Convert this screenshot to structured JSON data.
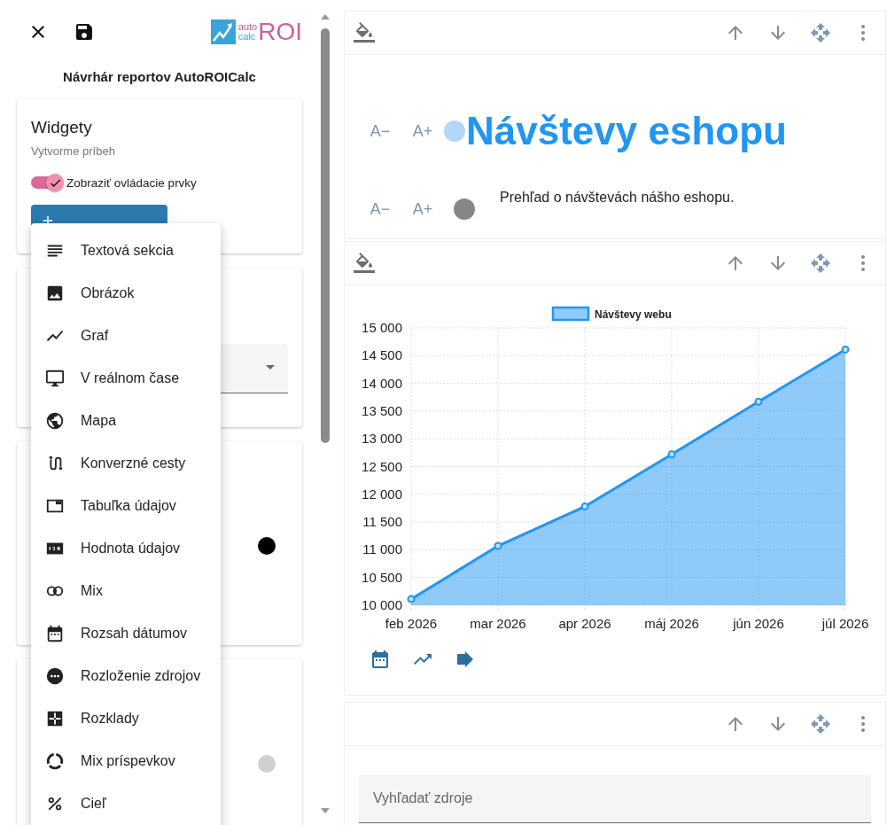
{
  "header": {
    "logo": {
      "top": "auto",
      "bottom": "calc",
      "main": "ROI"
    },
    "title": "Návrhár reportov AutoROICalc"
  },
  "widgets_card": {
    "title": "Widgety",
    "subtitle": "Vytvorme príbeh",
    "toggle": {
      "label": "Zobraziť ovládacie prvky",
      "on": true
    }
  },
  "add_menu": {
    "items": [
      {
        "label": "Textová sekcia"
      },
      {
        "label": "Obrázok"
      },
      {
        "label": "Graf"
      },
      {
        "label": "V reálnom čase"
      },
      {
        "label": "Mapa"
      },
      {
        "label": "Konverzné cesty"
      },
      {
        "label": "Tabuľka údajov"
      },
      {
        "label": "Hodnota údajov"
      },
      {
        "label": "Mix"
      },
      {
        "label": "Rozsah dátumov"
      },
      {
        "label": "Rozloženie zdrojov"
      },
      {
        "label": "Rozklady"
      },
      {
        "label": "Mix príspevkov"
      },
      {
        "label": "Cieľ"
      }
    ]
  },
  "text_widget": {
    "rows": [
      {
        "kind": "title",
        "decrease": "A−",
        "increase": "A+",
        "text": "Návštevy eshopu"
      },
      {
        "kind": "body",
        "decrease": "A−",
        "increase": "A+",
        "text": "Prehľad o návštevách nášho eshopu."
      }
    ]
  },
  "chart_widget": {
    "chart_data": {
      "type": "area",
      "categories": [
        "feb 2026",
        "mar 2026",
        "apr 2026",
        "máj 2026",
        "jún 2026",
        "júl 2026"
      ],
      "series": [
        {
          "name": "Návštevy webu",
          "color": "#2196f3",
          "values": [
            10110,
            11070,
            11780,
            12720,
            13670,
            14610
          ]
        }
      ],
      "ylim": [
        10000,
        15000
      ],
      "grid": true,
      "yticks": [
        {
          "value": 10000,
          "label": "10 000"
        },
        {
          "value": 10500,
          "label": "10 500"
        },
        {
          "value": 11000,
          "label": "11 000"
        },
        {
          "value": 11500,
          "label": "11 500"
        },
        {
          "value": 12000,
          "label": "12 000"
        },
        {
          "value": 12500,
          "label": "12 500"
        },
        {
          "value": 13000,
          "label": "13 000"
        },
        {
          "value": 13500,
          "label": "13 500"
        },
        {
          "value": 14000,
          "label": "14 000"
        },
        {
          "value": 14500,
          "label": "14 500"
        },
        {
          "value": 15000,
          "label": "15 000"
        }
      ]
    }
  },
  "search_widget": {
    "placeholder": "Vyhľadať zdroje"
  }
}
